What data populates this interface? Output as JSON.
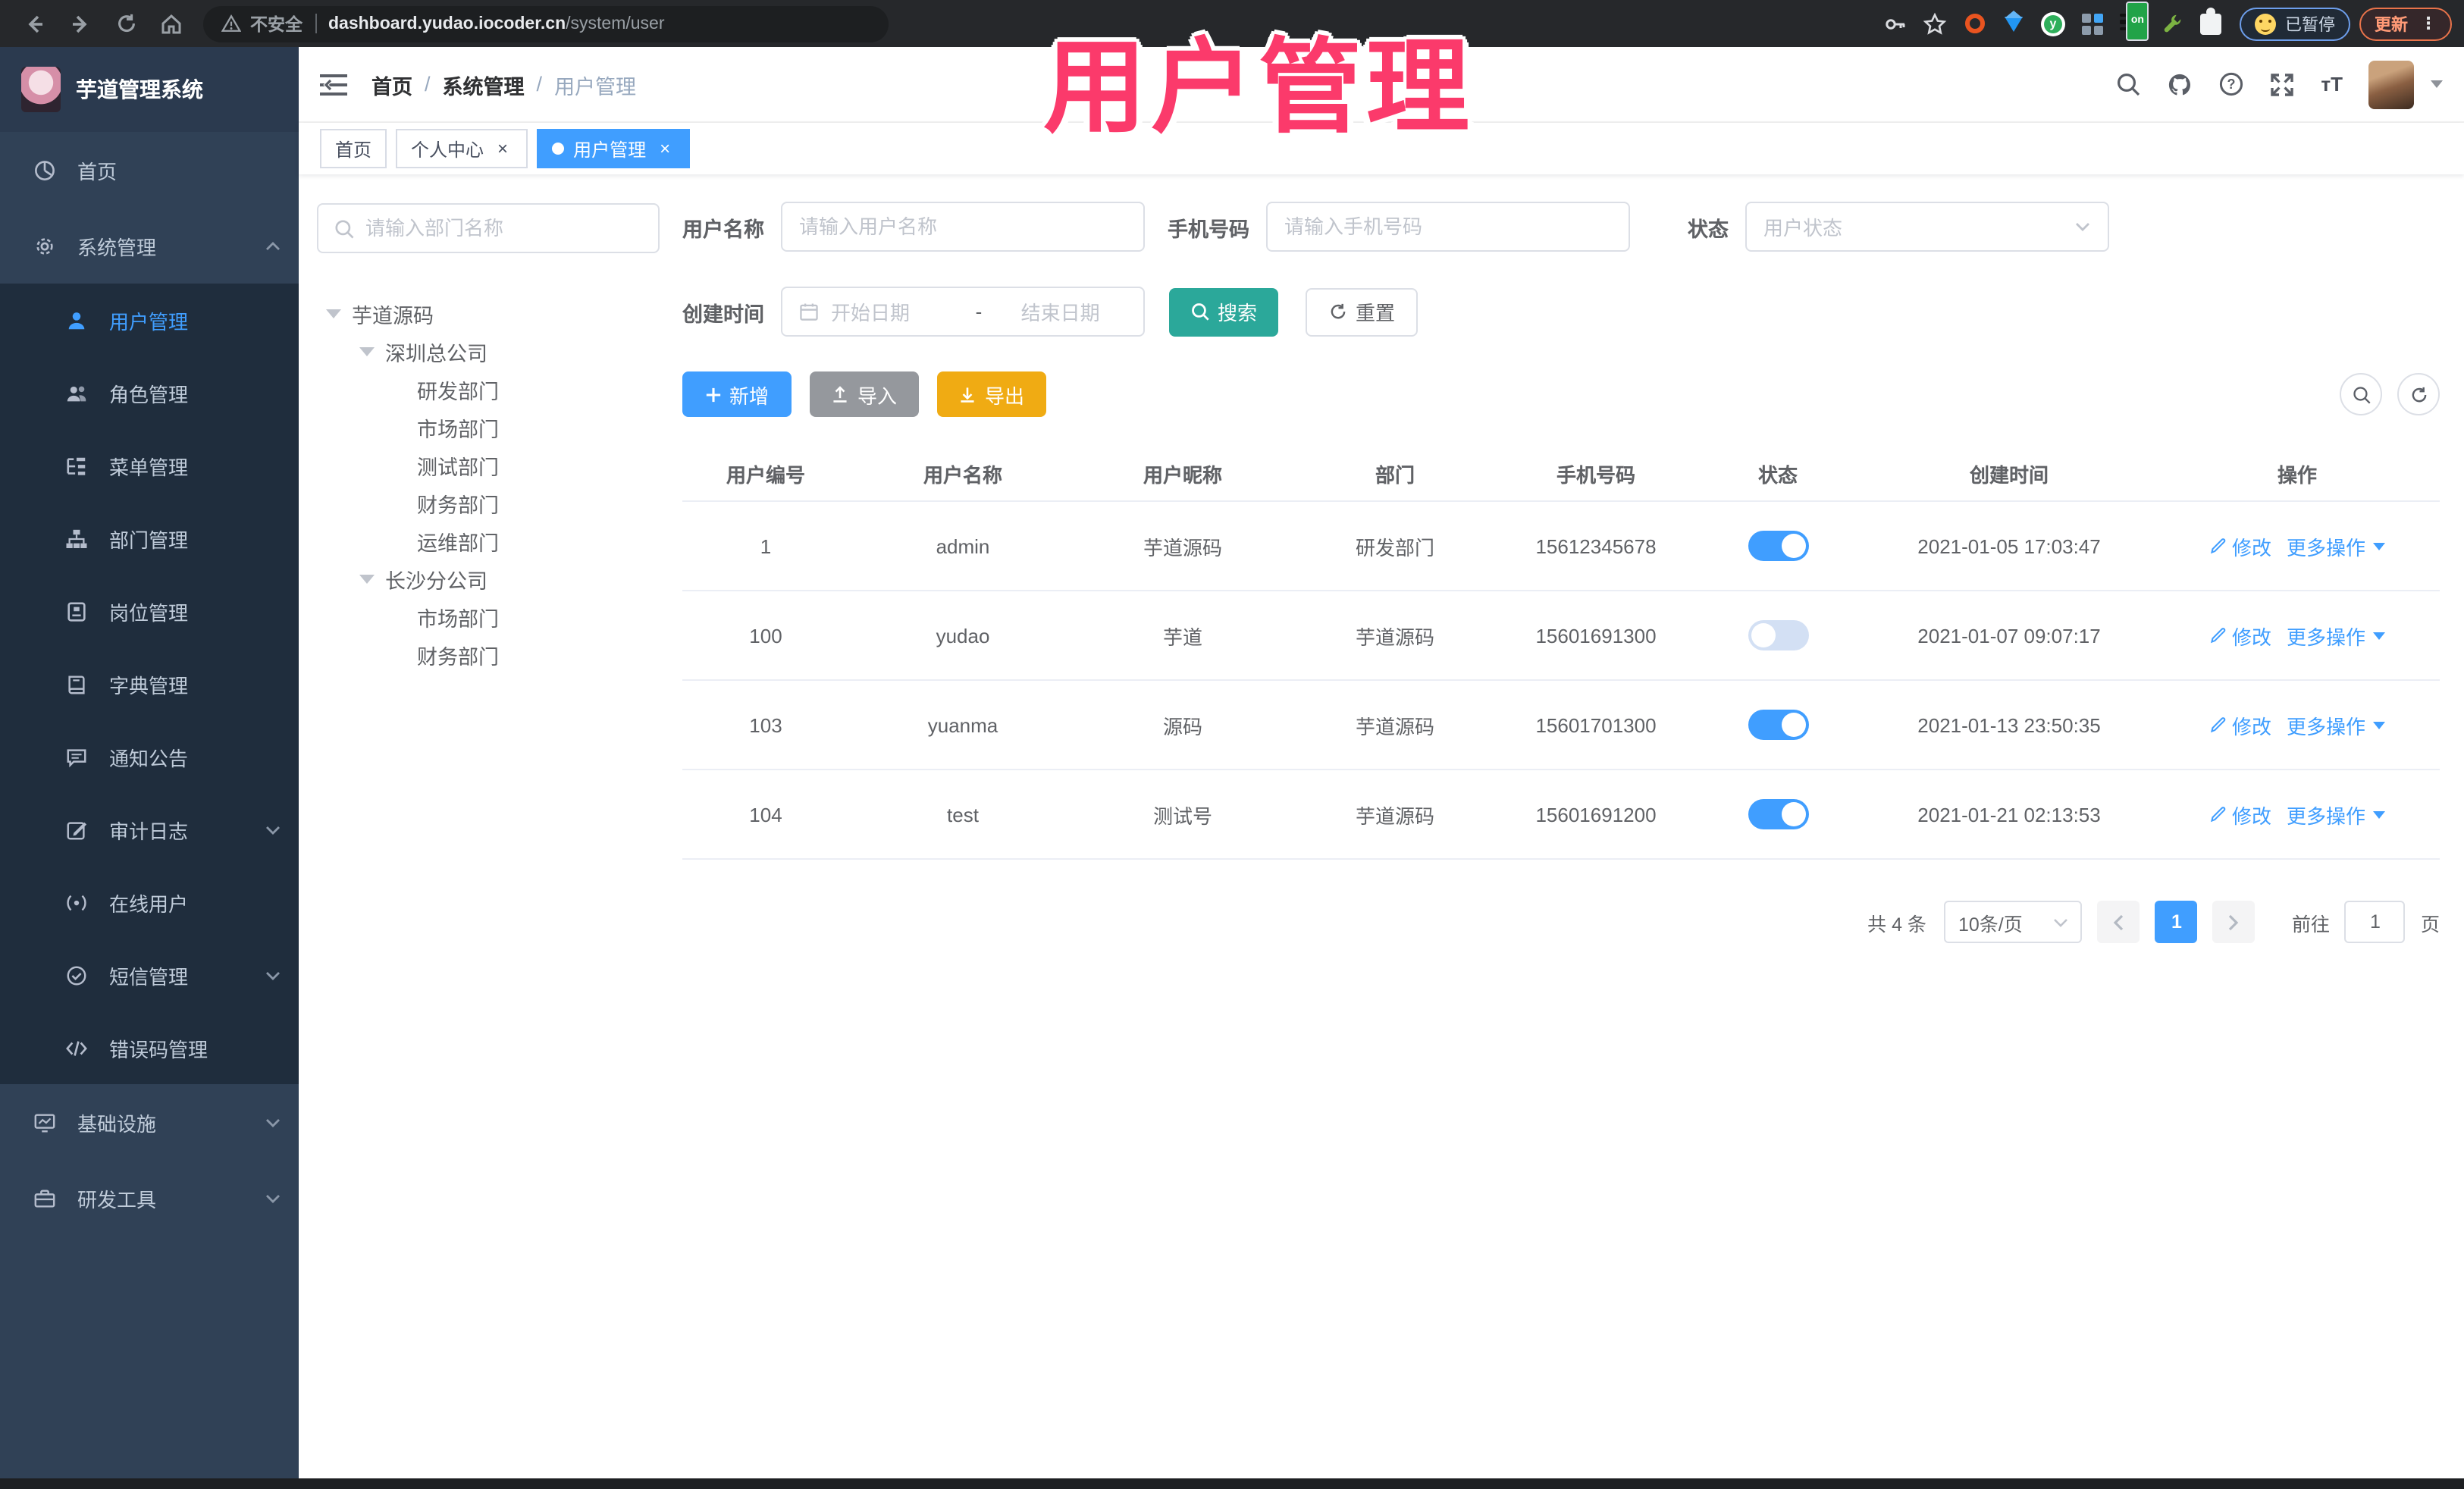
{
  "browser": {
    "insecure_label": "不安全",
    "url_host": "dashboard.yudao.iocoder.cn",
    "url_path": "/system/user",
    "paused_chip": "已暂停",
    "update_button": "更新",
    "on_badge": "on"
  },
  "overlay": {
    "text": "用户管理"
  },
  "sidebar": {
    "title": "芋道管理系统",
    "home": "首页",
    "system": "系统管理",
    "system_children": [
      "用户管理",
      "角色管理",
      "菜单管理",
      "部门管理",
      "岗位管理",
      "字典管理",
      "通知公告",
      "审计日志",
      "在线用户",
      "短信管理",
      "错误码管理"
    ],
    "infra": "基础设施",
    "devtools": "研发工具"
  },
  "header": {
    "breadcrumb": [
      "首页",
      "系统管理",
      "用户管理"
    ]
  },
  "tags": [
    "首页",
    "个人中心",
    "用户管理"
  ],
  "tree": {
    "search_placeholder": "请输入部门名称",
    "nodes": [
      "芋道源码",
      "深圳总公司",
      "研发部门",
      "市场部门",
      "测试部门",
      "财务部门",
      "运维部门",
      "长沙分公司",
      "市场部门",
      "财务部门"
    ]
  },
  "filters": {
    "username_label": "用户名称",
    "username_placeholder": "请输入用户名称",
    "mobile_label": "手机号码",
    "mobile_placeholder": "请输入手机号码",
    "status_label": "状态",
    "status_placeholder": "用户状态",
    "date_label": "创建时间",
    "date_start": "开始日期",
    "date_sep": "-",
    "date_end": "结束日期",
    "search_button": "搜索",
    "reset_button": "重置"
  },
  "toolbar": {
    "add": "新增",
    "import": "导入",
    "export": "导出"
  },
  "table": {
    "headers": [
      "用户编号",
      "用户名称",
      "用户昵称",
      "部门",
      "手机号码",
      "状态",
      "创建时间",
      "操作"
    ],
    "edit_label": "修改",
    "more_label": "更多操作",
    "rows": [
      {
        "id": "1",
        "username": "admin",
        "nickname": "芋道源码",
        "dept": "研发部门",
        "mobile": "15612345678",
        "status_on": true,
        "created": "2021-01-05 17:03:47"
      },
      {
        "id": "100",
        "username": "yudao",
        "nickname": "芋道",
        "dept": "芋道源码",
        "mobile": "15601691300",
        "status_on": false,
        "created": "2021-01-07 09:07:17"
      },
      {
        "id": "103",
        "username": "yuanma",
        "nickname": "源码",
        "dept": "芋道源码",
        "mobile": "15601701300",
        "status_on": true,
        "created": "2021-01-13 23:50:35"
      },
      {
        "id": "104",
        "username": "test",
        "nickname": "测试号",
        "dept": "芋道源码",
        "mobile": "15601691200",
        "status_on": true,
        "created": "2021-01-21 02:13:53"
      }
    ]
  },
  "pagination": {
    "total": "共 4 条",
    "page_size": "10条/页",
    "page": "1",
    "goto_label": "前往",
    "goto_value": "1",
    "page_suffix": "页"
  },
  "colors": {
    "accent": "#409eff",
    "search_teal": "#2ba89a",
    "export_amber": "#f0ab13",
    "annotation_pink": "#fb3a6b",
    "sidebar_bg": "#304156",
    "submenu_bg": "#1f2d3d"
  }
}
